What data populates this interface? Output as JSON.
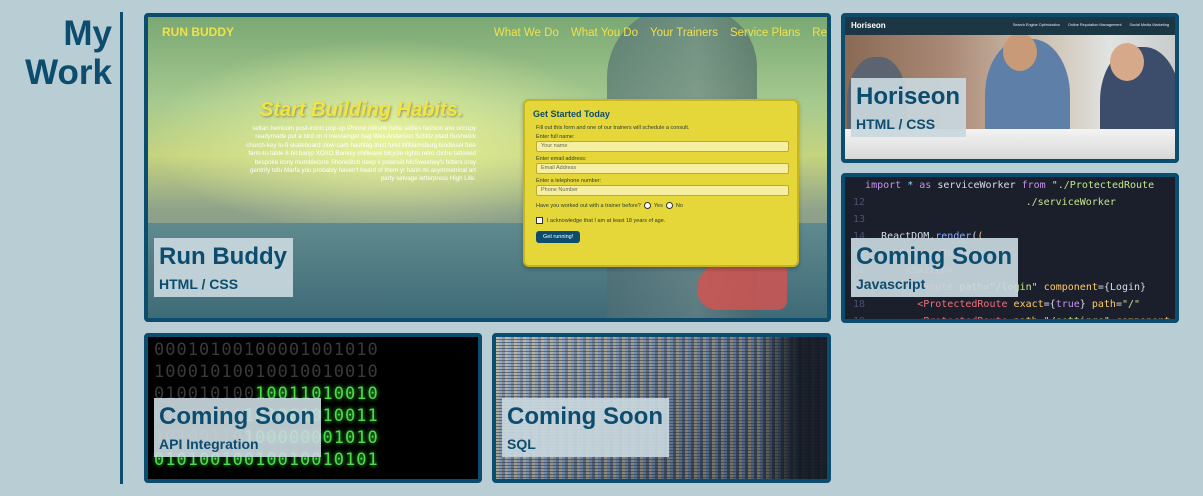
{
  "section": {
    "heading_line1": "My",
    "heading_line2": "Work"
  },
  "projects": [
    {
      "title": "Run Buddy",
      "tech": "HTML / CSS"
    },
    {
      "title": "Horiseon",
      "tech": "HTML / CSS"
    },
    {
      "title": "Coming Soon",
      "tech": "Javascript"
    },
    {
      "title": "Coming Soon",
      "tech": "API Integration"
    },
    {
      "title": "Coming Soon",
      "tech": "SQL"
    }
  ],
  "runbuddy_preview": {
    "logo": "RUN BUDDY",
    "nav": [
      "What We Do",
      "What You Do",
      "Your Trainers",
      "Service Plans",
      "Re"
    ],
    "hero_title": "Start Building Habits.",
    "hero_text": "seitan heirloom post-ironic pop-up iPhone mlkshk hella selfies fashion axe occupy readymade put a bird on it messenger bag Wes Anderson Schlitz plaid Bushwick church-key lo-fi skateboard slow-carb hashtag trust fund Williamsburg biodiesel fixie farm-to-table 8-bit banjo XOXO Banksy chillwave bicycle rights retro cliche tattooed bespoke irony mumblecore Shoreditch deep v polaroid McSweeney's bitters cray gentrify tofu Marfa you probably haven't heard of them yr banh mi asymmetrical art party selvage letterpress High Life.",
    "form_title": "Get Started Today",
    "form_subtitle": "Fill out this form and one of our trainers will schedule a consult.",
    "name_label": "Enter full name:",
    "name_placeholder": "Your name",
    "email_label": "Enter email address:",
    "email_placeholder": "Email Address",
    "phone_label": "Enter a telephone number:",
    "phone_placeholder": "Phone Number",
    "trainer_question": "Have you worked out with a trainer before?",
    "yes_label": "Yes",
    "no_label": "No",
    "acknowledge": "I acknowledge that I am at least 18 years of age.",
    "submit_label": "Get running!"
  },
  "horiseon_preview": {
    "logo": "Horiseon",
    "nav": [
      "Search Engine Optimization",
      "Online Reputation Management",
      "Social Media Marketing"
    ]
  },
  "colors": {
    "page_background": "#b9cdd5",
    "accent": "#0c4c6f",
    "label_background": "#c9d8de",
    "runbuddy_yellow": "#f0e14b"
  }
}
